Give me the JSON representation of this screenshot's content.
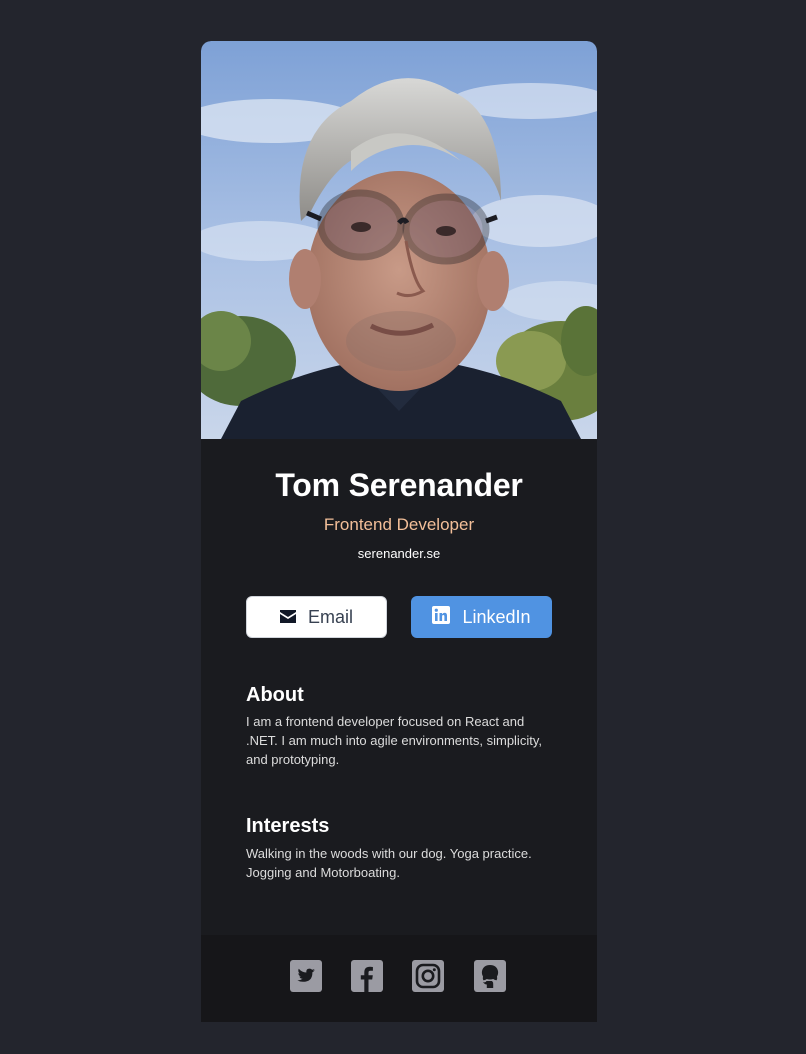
{
  "profile": {
    "name": "Tom Serenander",
    "role": "Frontend Developer",
    "website": "serenander.se"
  },
  "buttons": {
    "email_label": "Email",
    "email_icon": "envelope-icon",
    "linkedin_label": "LinkedIn",
    "linkedin_icon": "linkedin-icon"
  },
  "about": {
    "title": "About",
    "text": "I am a frontend developer focused on React and .NET. I am much into agile environments, simplicity, and prototyping."
  },
  "interests": {
    "title": "Interests",
    "text": "Walking in the woods with our dog. Yoga practice. Jogging and Motorboating."
  },
  "footer": {
    "icons": [
      "twitter-icon",
      "facebook-icon",
      "instagram-icon",
      "github-icon"
    ]
  },
  "colors": {
    "page_background": "#23252d",
    "card_background": "#1a1b1f",
    "footer_background": "#161619",
    "accent_role": "#f3bf99",
    "linkedin_button": "#5093e2",
    "social_icon": "#9b9ba3"
  }
}
